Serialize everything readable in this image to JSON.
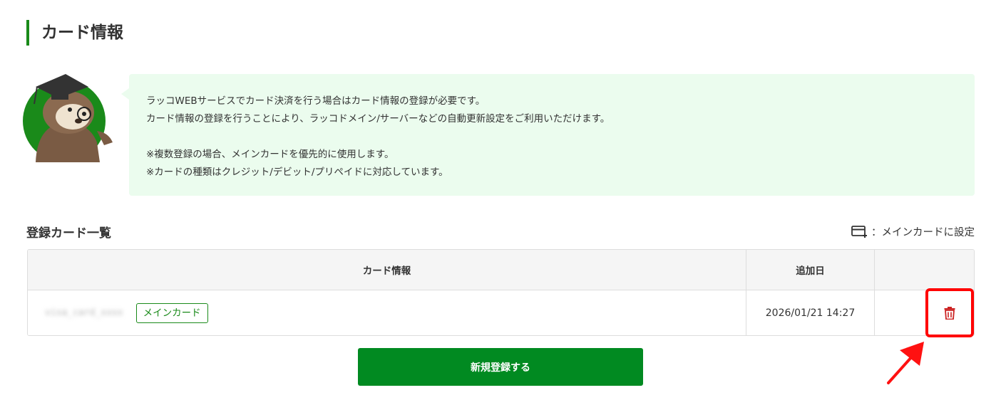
{
  "page": {
    "title": "カード情報"
  },
  "info": {
    "lines": [
      "ラッコWEBサービスでカード決済を行う場合はカード情報の登録が必要です。",
      "カード情報の登録を行うことにより、ラッコドメイン/サーバーなどの自動更新設定をご利用いただけます。",
      "",
      "※複数登録の場合、メインカードを優先的に使用します。",
      "※カードの種類はクレジット/デビット/プリペイドに対応しています。"
    ]
  },
  "cards_section": {
    "title": "登録カード一覧",
    "legend_label": "：メインカードに設定",
    "legend_icon": "card-add-icon",
    "columns": [
      "カード情報",
      "追加日"
    ],
    "rows": [
      {
        "card_label": "visa_card_xxxx",
        "badge": "メインカード",
        "added": "2026/01/21 14:27",
        "action_icon": "trash-icon"
      }
    ]
  },
  "actions": {
    "new_register_label": "新規登録する"
  },
  "colors": {
    "accent_green": "#1a8a1a",
    "button_green": "#018a21",
    "info_bg": "#ebfcee",
    "delete_red": "#cc2222",
    "annotation_red": "#ff0000"
  }
}
